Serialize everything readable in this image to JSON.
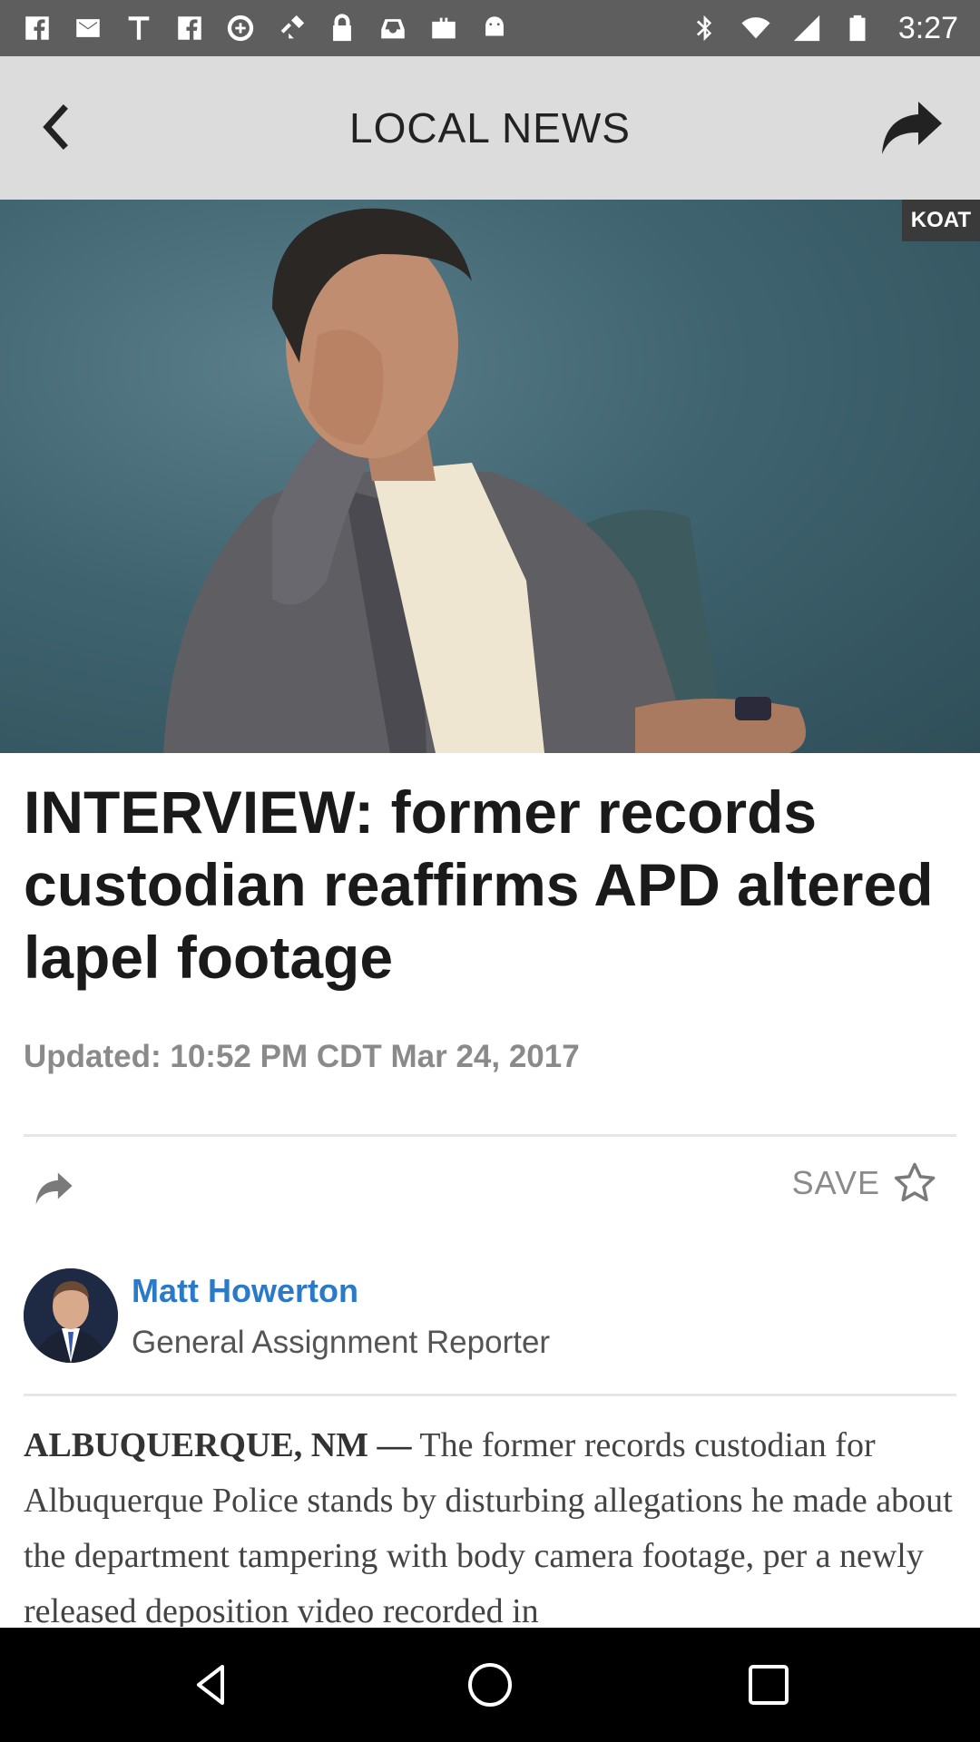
{
  "status_bar": {
    "time": "3:27",
    "left_icons": [
      "facebook-icon",
      "mail-icon",
      "text-icon",
      "facebook-icon",
      "data-saver-icon",
      "fake-gps-icon",
      "lock-icon",
      "inbox-icon",
      "briefcase-icon",
      "android-icon"
    ],
    "right_icons": [
      "bluetooth-icon",
      "wifi-icon",
      "signal-icon",
      "battery-icon"
    ]
  },
  "header": {
    "title": "LOCAL NEWS"
  },
  "hero": {
    "credit": "KOAT"
  },
  "article": {
    "headline": "INTERVIEW: former records custodian reaffirms APD altered lapel footage",
    "updated": "Updated: 10:52 PM CDT Mar 24, 2017",
    "save_label": "SAVE",
    "author": {
      "name": "Matt Howerton",
      "role": "General Assignment Reporter"
    },
    "dateline": "ALBUQUERQUE, NM —",
    "body": "The former records custodian for Albuquerque Police stands by disturbing allegations he made about the department tampering with body camera footage, per a newly released deposition video recorded in"
  },
  "colors": {
    "header_bg": "#dcdcdc",
    "status_bg": "#5e5e5e",
    "author_link": "#2a7ac9"
  }
}
